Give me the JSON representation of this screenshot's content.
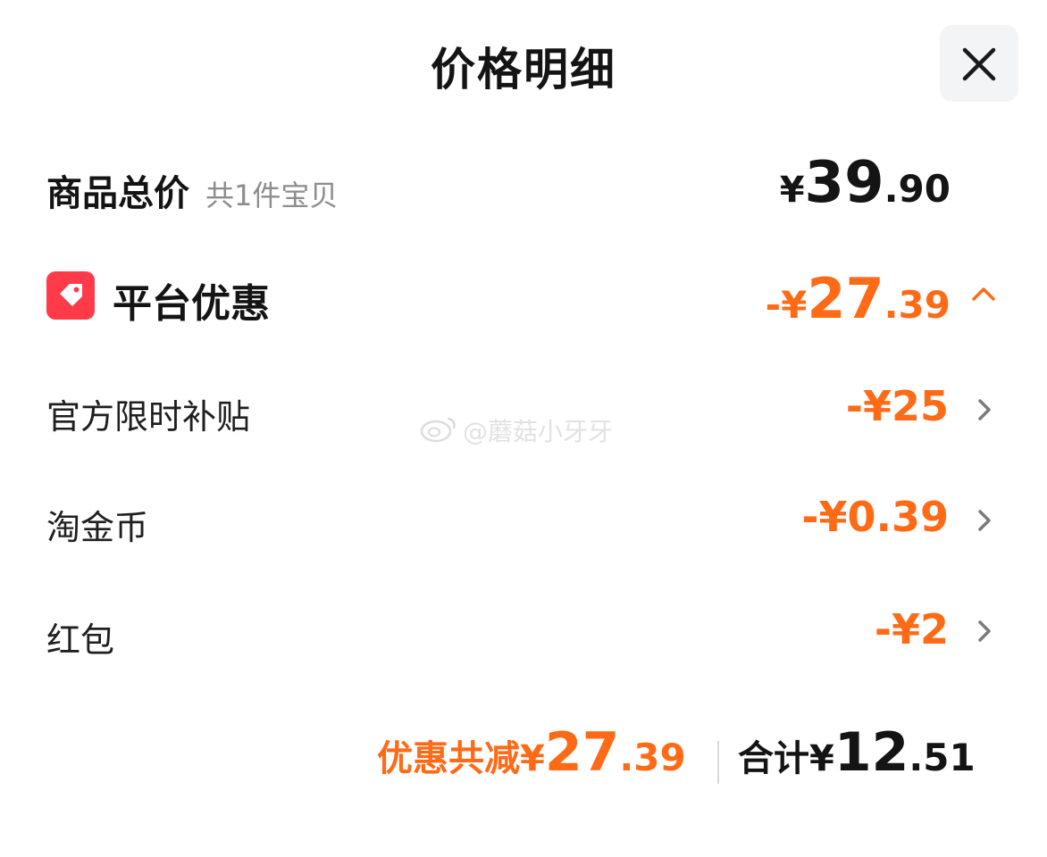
{
  "header": {
    "title": "价格明细",
    "close_icon": "close-icon"
  },
  "total_goods": {
    "label": "商品总价",
    "sub": "共1件宝贝",
    "currency": "¥",
    "int": "39",
    "dec": ".90"
  },
  "platform_discount": {
    "icon": "coupon-tag-icon",
    "label": "平台优惠",
    "prefix": "-¥",
    "int": "27",
    "dec": ".39",
    "expanded": true
  },
  "items": [
    {
      "label": "官方限时补贴",
      "amount": "-¥25"
    },
    {
      "label": "淘金币",
      "amount": "-¥0.39"
    },
    {
      "label": "红包",
      "amount": "-¥2"
    }
  ],
  "watermark": {
    "text": "@蘑菇小牙牙",
    "icon": "weibo-icon"
  },
  "footer": {
    "discount_label": "优惠共减¥",
    "discount_int": "27",
    "discount_dec": ".39",
    "total_label": "合计¥",
    "total_int": "12",
    "total_dec": ".51"
  },
  "colors": {
    "accent": "#ff6a17",
    "tag": "#ff3b4a",
    "text": "#141414",
    "muted": "#8d8d8d"
  }
}
